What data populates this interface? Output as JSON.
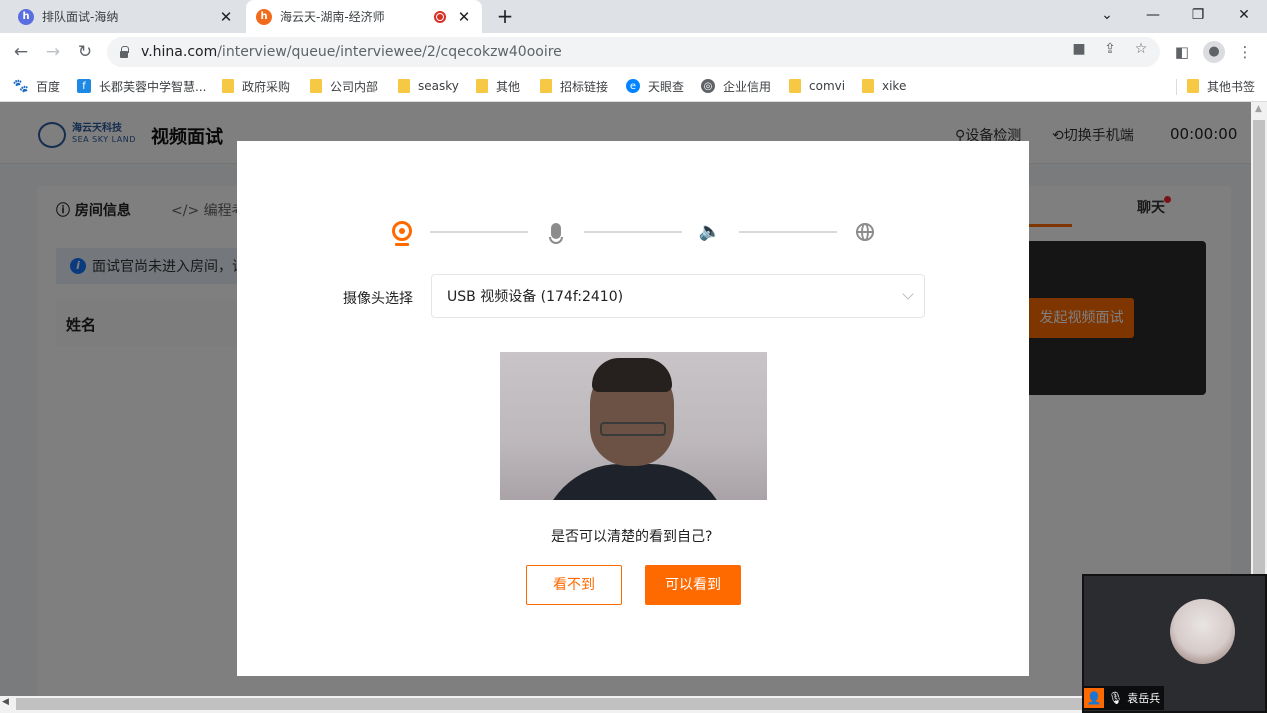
{
  "browser": {
    "tabs": [
      {
        "title": "排队面试-海纳",
        "favicon": "h"
      },
      {
        "title": "海云天-湖南-经济师",
        "favicon": "h"
      }
    ],
    "url_host": "v.hina.com",
    "url_path": "/interview/queue/interviewee/2/cqecokzw40ooire",
    "bookmarks": [
      "百度",
      "长郡芙蓉中学智慧...",
      "政府采购",
      "公司内部",
      "seasky",
      "其他",
      "招标链接",
      "天眼查",
      "企业信用",
      "comvi",
      "xike"
    ],
    "other_bookmarks": "其他书签"
  },
  "header": {
    "logo_cn": "海云天科技",
    "logo_en": "SEA SKY LAND",
    "title": "视频面试",
    "device_check": "设备检测",
    "switch_mobile": "切换手机端",
    "timer": "00:00:00"
  },
  "left": {
    "tab_room": "房间信息",
    "tab_coding": "编程考",
    "notice": "面试官尚未进入房间，请",
    "col_name": "姓名"
  },
  "right": {
    "tab_chat": "聊天",
    "start_video": "发起视频面试"
  },
  "modal": {
    "camera_label": "摄像头选择",
    "camera_value": "USB 视频设备 (174f:2410)",
    "question": "是否可以清楚的看到自己?",
    "btn_cannot": "看不到",
    "btn_can": "可以看到"
  },
  "float": {
    "name": "袁岳兵"
  },
  "colors": {
    "accent": "#ff6a00",
    "info": "#1677ff"
  }
}
